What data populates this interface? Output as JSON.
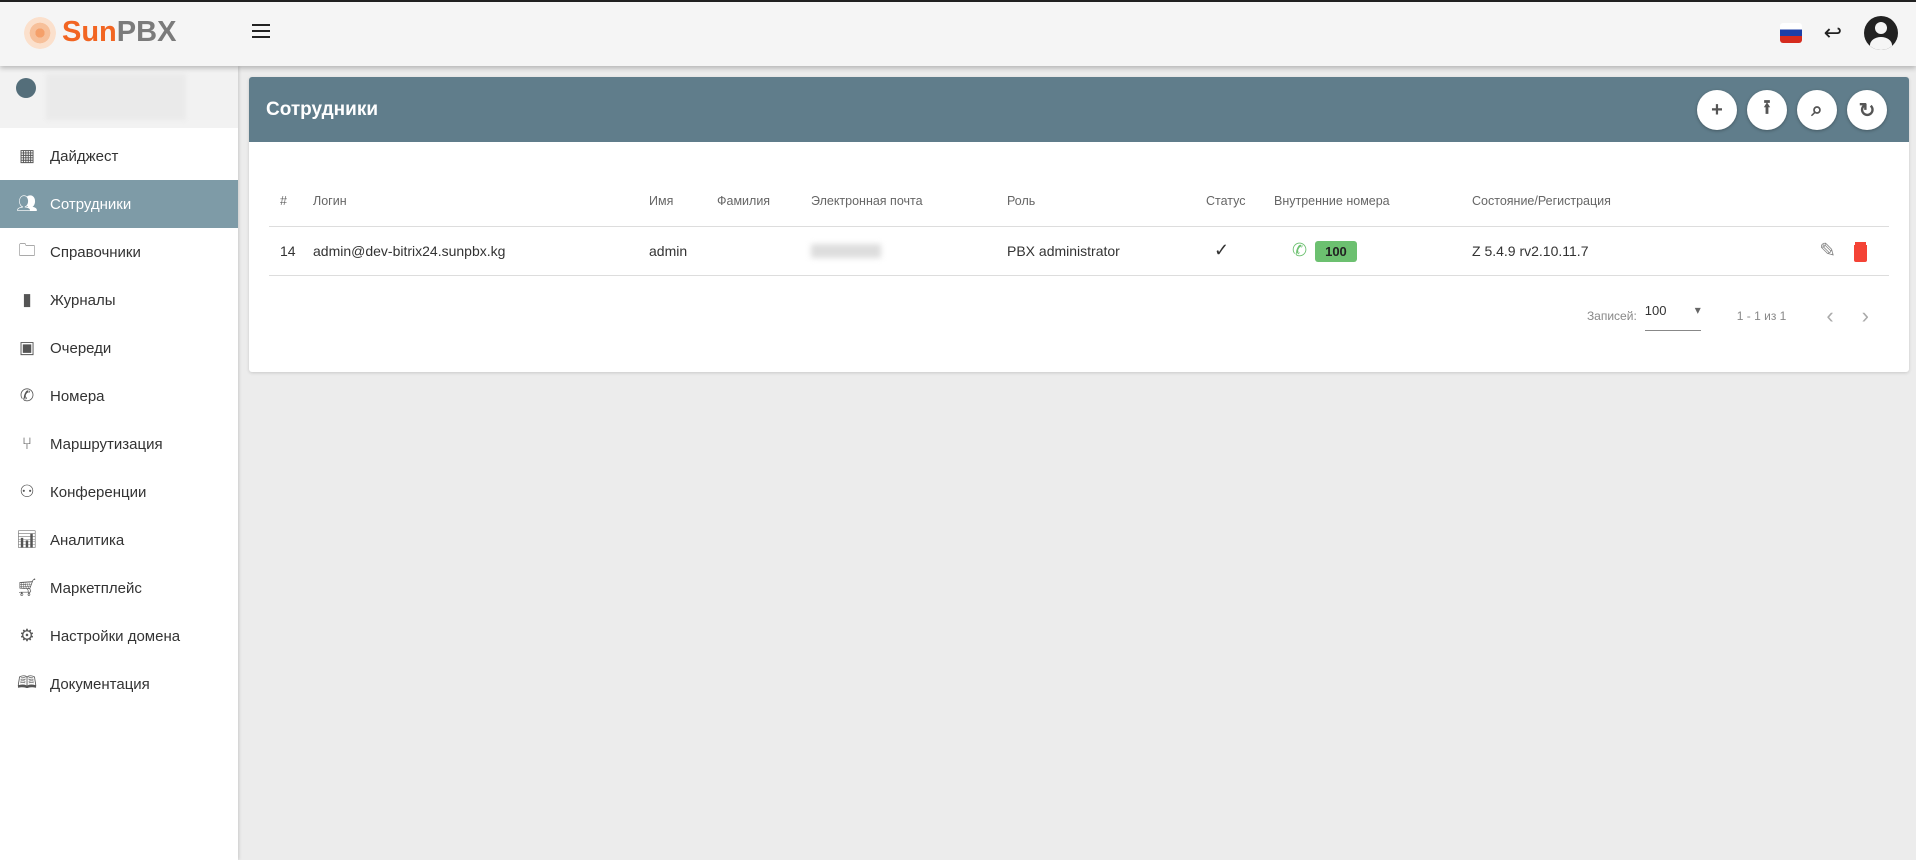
{
  "app": {
    "logo_sun": "Sun",
    "logo_pbx": "PBX"
  },
  "sidebar": {
    "items": [
      {
        "label": "Дайджест",
        "icon": "dashboard-icon"
      },
      {
        "label": "Сотрудники",
        "icon": "people-icon"
      },
      {
        "label": "Справочники",
        "icon": "folder-icon"
      },
      {
        "label": "Журналы",
        "icon": "book-icon"
      },
      {
        "label": "Очереди",
        "icon": "contact-icon"
      },
      {
        "label": "Номера",
        "icon": "phone-icon"
      },
      {
        "label": "Маршрутизация",
        "icon": "route-icon"
      },
      {
        "label": "Конференции",
        "icon": "groups-icon"
      },
      {
        "label": "Аналитика",
        "icon": "chart-icon"
      },
      {
        "label": "Маркетплейс",
        "icon": "basket-icon"
      },
      {
        "label": "Настройки домена",
        "icon": "gear-icon"
      },
      {
        "label": "Документация",
        "icon": "docs-icon"
      }
    ]
  },
  "page": {
    "title": "Сотрудники"
  },
  "table": {
    "headers": [
      "#",
      "Логин",
      "Имя",
      "Фамилия",
      "Электронная почта",
      "Роль",
      "Статус",
      "Внутренние номера",
      "Состояние/Регистрация"
    ],
    "rows": [
      {
        "id": "14",
        "login": "admin@dev-bitrix24.sunpbx.kg",
        "name": "admin",
        "surname": "",
        "role": "PBX administrator",
        "extension": "100",
        "state": "Z 5.4.9 rv2.10.11.7"
      }
    ]
  },
  "pagination": {
    "label": "Записей:",
    "per_page": "100",
    "range": "1 - 1 из 1"
  }
}
